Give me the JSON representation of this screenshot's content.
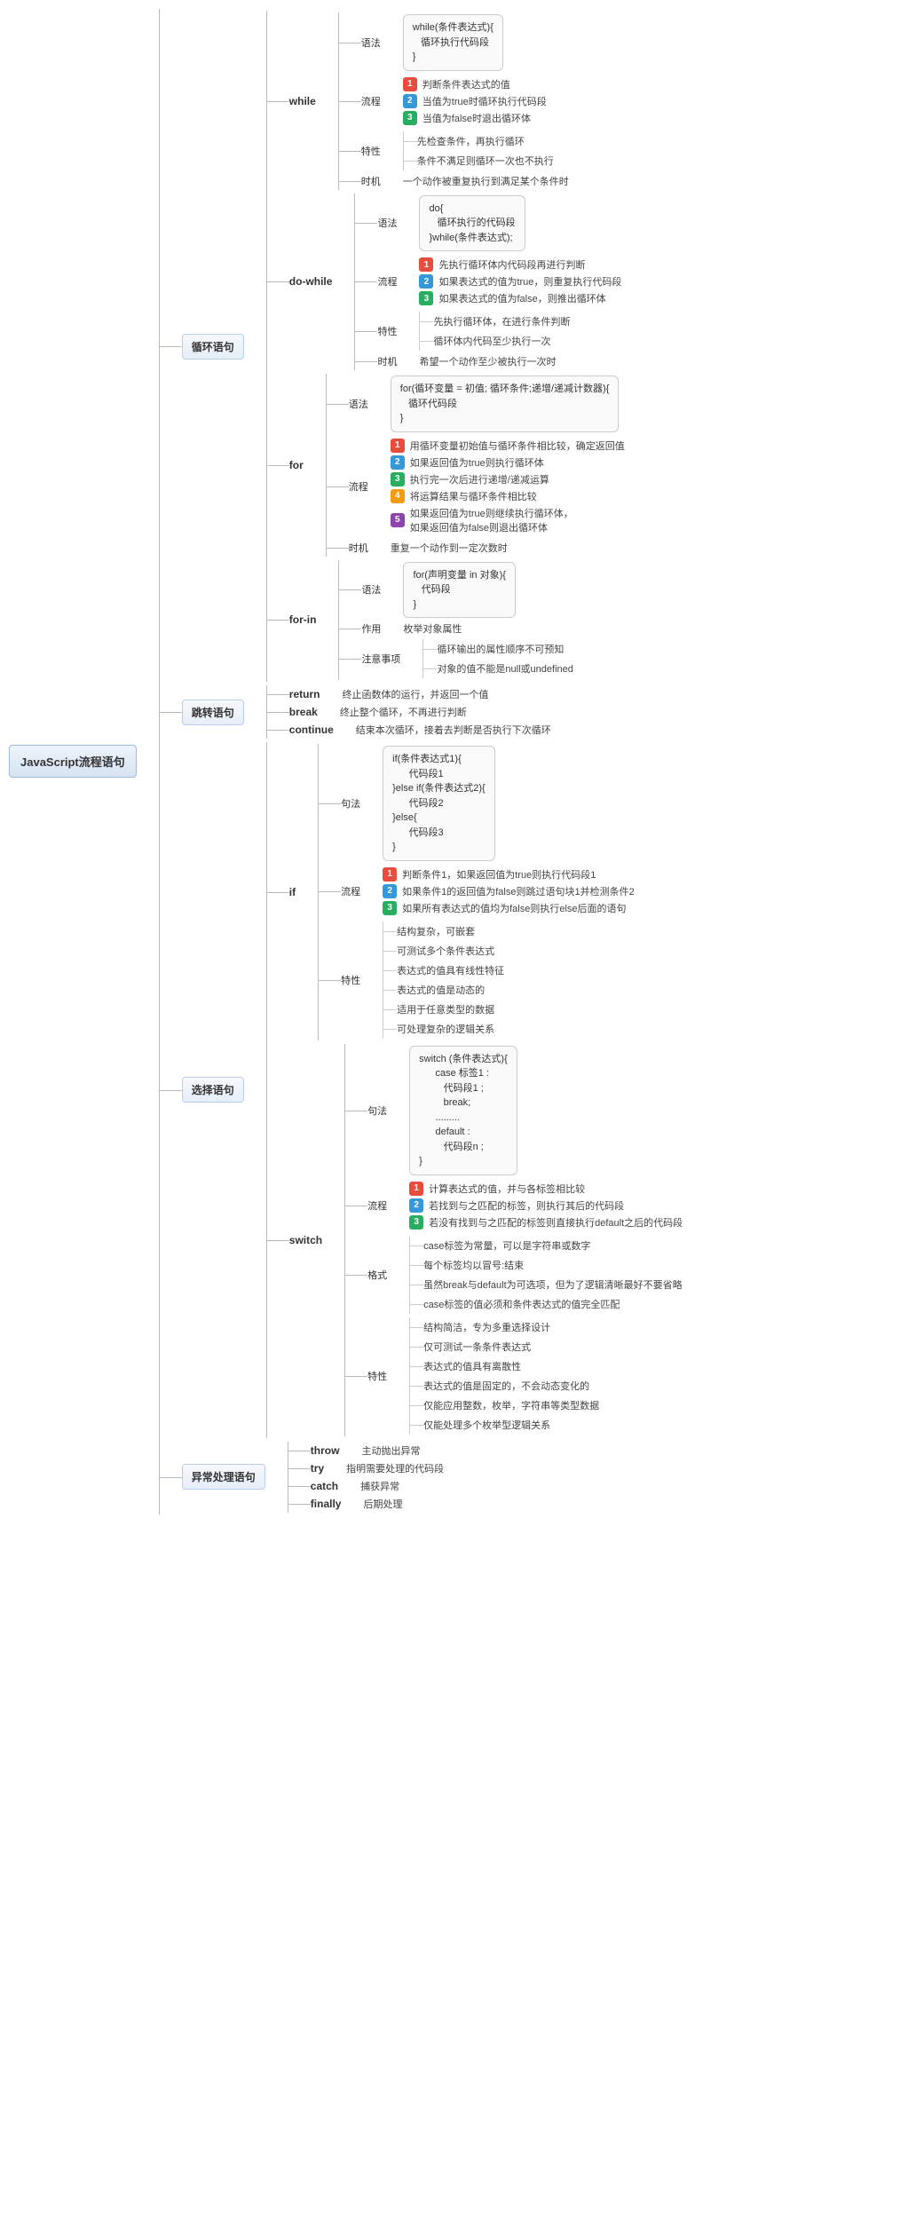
{
  "root": "JavaScript流程语句",
  "cat": {
    "loop": "循环语句",
    "jump": "跳转语句",
    "select": "选择语句",
    "except": "异常处理语句"
  },
  "k": {
    "syntax": "语法",
    "sentence": "句法",
    "flow": "流程",
    "feat": "特性",
    "timing": "时机",
    "use": "作用",
    "note": "注意事项",
    "format": "格式"
  },
  "while": {
    "name": "while",
    "code": "while(条件表达式){\n   循环执行代码段\n}",
    "flow": [
      "判断条件表达式的值",
      "当值为true时循环执行代码段",
      "当值为false时退出循环体"
    ],
    "feat": [
      "先检查条件，再执行循环",
      "条件不满足则循环一次也不执行"
    ],
    "timing": "一个动作被重复执行到满足某个条件时"
  },
  "dowhile": {
    "name": "do-while",
    "code": "do{\n   循环执行的代码段\n}while(条件表达式);",
    "flow": [
      "先执行循环体内代码段再进行判断",
      "如果表达式的值为true，则重复执行代码段",
      "如果表达式的值为false，则推出循环体"
    ],
    "feat": [
      "先执行循环体，在进行条件判断",
      "循环体内代码至少执行一次"
    ],
    "timing": "希望一个动作至少被执行一次时"
  },
  "forloop": {
    "name": "for",
    "code": "for(循环变量 = 初值; 循环条件;递增/递减计数器){\n   循环代码段\n}",
    "flow": [
      "用循环变量初始值与循环条件相比较，确定返回值",
      "如果返回值为true则执行循环体",
      "执行完一次后进行递增/递减运算",
      "将运算结果与循环条件相比较",
      "如果返回值为true则继续执行循环体，\n如果返回值为false则退出循环体"
    ],
    "timing": "重复一个动作到一定次数时"
  },
  "forin": {
    "name": "for-in",
    "code": "for(声明变量 in 对象){\n   代码段\n}",
    "use": "枚举对象属性",
    "note": [
      "循环输出的属性顺序不可预知",
      "对象的值不能是null或undefined"
    ]
  },
  "ret": {
    "name": "return",
    "desc": "终止函数体的运行，并返回一个值"
  },
  "brk": {
    "name": "break",
    "desc": "终止整个循环，不再进行判断"
  },
  "cont": {
    "name": "continue",
    "desc": "结束本次循环，接着去判断是否执行下次循环"
  },
  "ifs": {
    "name": "if",
    "code": "if(条件表达式1){\n      代码段1\n}else if(条件表达式2){\n      代码段2\n}else{\n      代码段3\n}",
    "flow": [
      "判断条件1，如果返回值为true则执行代码段1",
      "如果条件1的返回值为false则跳过语句块1并检测条件2",
      "如果所有表达式的值均为false则执行else后面的语句"
    ],
    "feat": [
      "结构复杂，可嵌套",
      "可测试多个条件表达式",
      "表达式的值具有线性特征",
      "表达式的值是动态的",
      "适用于任意类型的数据",
      "可处理复杂的逻辑关系"
    ]
  },
  "sw": {
    "name": "switch",
    "code": "switch (条件表达式){\n      case 标签1 :\n         代码段1 ;\n         break;\n      .........\n      default :\n         代码段n ;\n}",
    "flow": [
      "计算表达式的值，并与各标签相比较",
      "若找到与之匹配的标签，则执行其后的代码段",
      "若没有找到与之匹配的标签则直接执行default之后的代码段"
    ],
    "format": [
      "case标签为常量，可以是字符串或数字",
      "每个标签均以冒号:结束",
      "虽然break与default为可选项，但为了逻辑清晰最好不要省略",
      "case标签的值必须和条件表达式的值完全匹配"
    ],
    "feat": [
      "结构简洁，专为多重选择设计",
      "仅可测试一条条件表达式",
      "表达式的值具有离散性",
      "表达式的值是固定的，不会动态变化的",
      "仅能应用整数，枚举，字符串等类型数据",
      "仅能处理多个枚举型逻辑关系"
    ]
  },
  "thr": {
    "name": "throw",
    "desc": "主动抛出异常"
  },
  "tryb": {
    "name": "try",
    "desc": "指明需要处理的代码段"
  },
  "cat2": {
    "name": "catch",
    "desc": "捕获异常"
  },
  "fin": {
    "name": "finally",
    "desc": "后期处理"
  }
}
